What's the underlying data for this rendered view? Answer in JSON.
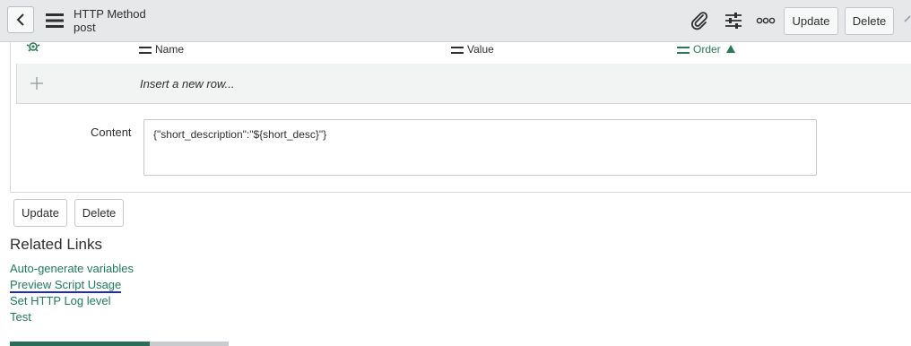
{
  "header": {
    "title": "HTTP Method",
    "subtitle": "post",
    "update_label": "Update",
    "delete_label": "Delete"
  },
  "list": {
    "columns": [
      {
        "label": "Name"
      },
      {
        "label": "Value"
      },
      {
        "label": "Order",
        "sorted": "ascending"
      }
    ],
    "insert_row_text": "Insert a new row..."
  },
  "form": {
    "content_label": "Content",
    "content_value": "{\"short_description\":\"${short_desc}\"}"
  },
  "buttons": {
    "update_label": "Update",
    "delete_label": "Delete"
  },
  "related_links": {
    "title": "Related Links",
    "items": [
      "Auto-generate variables",
      "Preview Script Usage",
      "Set HTTP Log level",
      "Test"
    ]
  },
  "colors": {
    "link": "#1f7a5c",
    "active_sort": "#2a7a57",
    "annotation_underline": "#1f2bbf"
  },
  "icons": [
    "back-icon",
    "menu-icon",
    "paperclip-icon",
    "sliders-icon",
    "more-icon",
    "gear-icon",
    "plus-icon",
    "sort-up-icon"
  ]
}
